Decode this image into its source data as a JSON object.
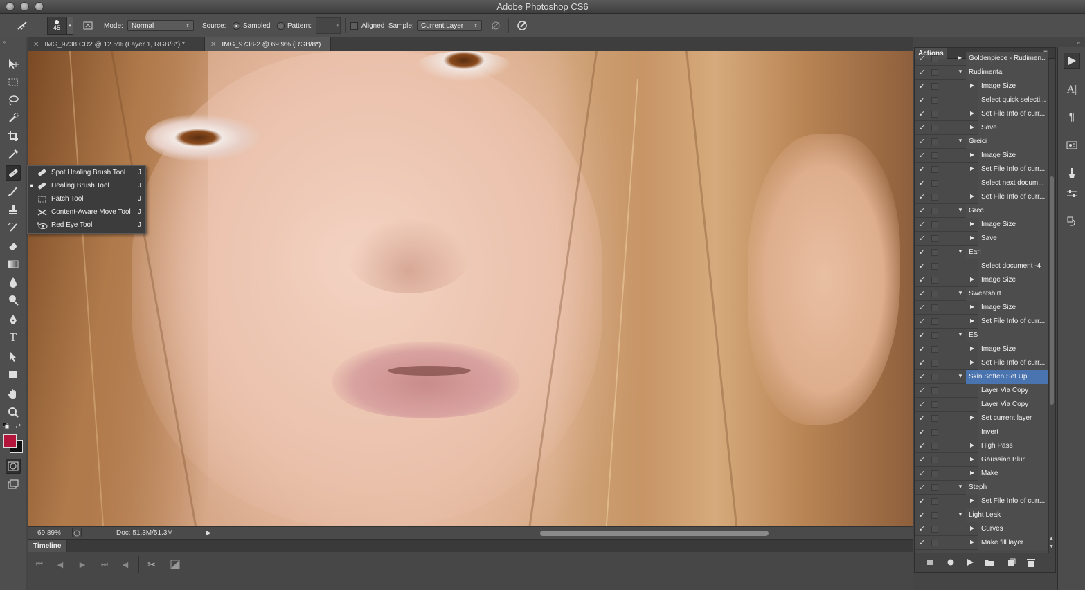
{
  "app": {
    "title": "Adobe Photoshop CS6"
  },
  "options_bar": {
    "brush_size": "45",
    "mode_label": "Mode:",
    "mode_value": "Normal",
    "source_label": "Source:",
    "sampled_label": "Sampled",
    "pattern_label": "Pattern:",
    "aligned_label": "Aligned",
    "sample_label": "Sample:",
    "sample_value": "Current Layer"
  },
  "tabs": [
    {
      "title": "IMG_9738.CR2 @ 12.5% (Layer 1, RGB/8*) *"
    },
    {
      "title": "IMG_9738-2 @ 69.9% (RGB/8*)"
    }
  ],
  "flyout": {
    "items": [
      {
        "label": "Spot Healing Brush Tool",
        "shortcut": "J",
        "icon": "spot-healing-icon"
      },
      {
        "label": "Healing Brush Tool",
        "shortcut": "J",
        "icon": "healing-brush-icon"
      },
      {
        "label": "Patch Tool",
        "shortcut": "J",
        "icon": "patch-icon"
      },
      {
        "label": "Content-Aware Move Tool",
        "shortcut": "J",
        "icon": "content-aware-move-icon"
      },
      {
        "label": "Red Eye Tool",
        "shortcut": "J",
        "icon": "red-eye-icon"
      }
    ]
  },
  "status": {
    "zoom": "69.89%",
    "doc": "Doc: 51.3M/51.3M"
  },
  "timeline": {
    "tab": "Timeline"
  },
  "actions_panel": {
    "title": "Actions",
    "rows": [
      {
        "label": "Goldenpiece - Rudimen...",
        "level": 1,
        "expand": "collapsed"
      },
      {
        "label": "Rudimental",
        "level": 1,
        "expand": "expanded"
      },
      {
        "label": "Image Size",
        "level": 2,
        "expand": "collapsed"
      },
      {
        "label": "Select quick selecti...",
        "level": 2,
        "expand": "none"
      },
      {
        "label": "Set File Info of curr...",
        "level": 2,
        "expand": "collapsed"
      },
      {
        "label": "Save",
        "level": 2,
        "expand": "collapsed"
      },
      {
        "label": "Greici",
        "level": 1,
        "expand": "expanded"
      },
      {
        "label": "Image Size",
        "level": 2,
        "expand": "collapsed"
      },
      {
        "label": "Set File Info of curr...",
        "level": 2,
        "expand": "collapsed"
      },
      {
        "label": "Select next docum...",
        "level": 2,
        "expand": "none"
      },
      {
        "label": "Set File Info of curr...",
        "level": 2,
        "expand": "collapsed"
      },
      {
        "label": "Grec",
        "level": 1,
        "expand": "expanded"
      },
      {
        "label": "Image Size",
        "level": 2,
        "expand": "collapsed"
      },
      {
        "label": "Save",
        "level": 2,
        "expand": "collapsed"
      },
      {
        "label": "Earl",
        "level": 1,
        "expand": "expanded"
      },
      {
        "label": "Select document -4",
        "level": 2,
        "expand": "none"
      },
      {
        "label": "Image Size",
        "level": 2,
        "expand": "collapsed"
      },
      {
        "label": "Sweatshirt",
        "level": 1,
        "expand": "expanded"
      },
      {
        "label": "Image Size",
        "level": 2,
        "expand": "collapsed"
      },
      {
        "label": "Set File Info of curr...",
        "level": 2,
        "expand": "collapsed"
      },
      {
        "label": "ES",
        "level": 1,
        "expand": "expanded"
      },
      {
        "label": "Image Size",
        "level": 2,
        "expand": "collapsed"
      },
      {
        "label": "Set File Info of curr...",
        "level": 2,
        "expand": "collapsed"
      },
      {
        "label": "Skin Soften Set Up",
        "level": 1,
        "expand": "expanded",
        "selected": true
      },
      {
        "label": "Layer Via Copy",
        "level": 2,
        "expand": "none"
      },
      {
        "label": "Layer Via Copy",
        "level": 2,
        "expand": "none"
      },
      {
        "label": "Set current layer",
        "level": 2,
        "expand": "collapsed"
      },
      {
        "label": "Invert",
        "level": 2,
        "expand": "none"
      },
      {
        "label": "High Pass",
        "level": 2,
        "expand": "collapsed"
      },
      {
        "label": "Gaussian Blur",
        "level": 2,
        "expand": "collapsed"
      },
      {
        "label": "Make",
        "level": 2,
        "expand": "collapsed"
      },
      {
        "label": "Steph",
        "level": 1,
        "expand": "expanded"
      },
      {
        "label": "Set File Info of curr...",
        "level": 2,
        "expand": "collapsed"
      },
      {
        "label": "Light Leak",
        "level": 1,
        "expand": "expanded"
      },
      {
        "label": "Curves",
        "level": 2,
        "expand": "collapsed"
      },
      {
        "label": "Make fill layer",
        "level": 2,
        "expand": "collapsed"
      }
    ]
  },
  "colors": {
    "foreground": "#b3163a",
    "background": "#111111",
    "selection": "#4a74b0"
  },
  "glyphs": {
    "check": "✓",
    "collapsed": "▶",
    "expanded": "▼",
    "bullet": "■"
  }
}
